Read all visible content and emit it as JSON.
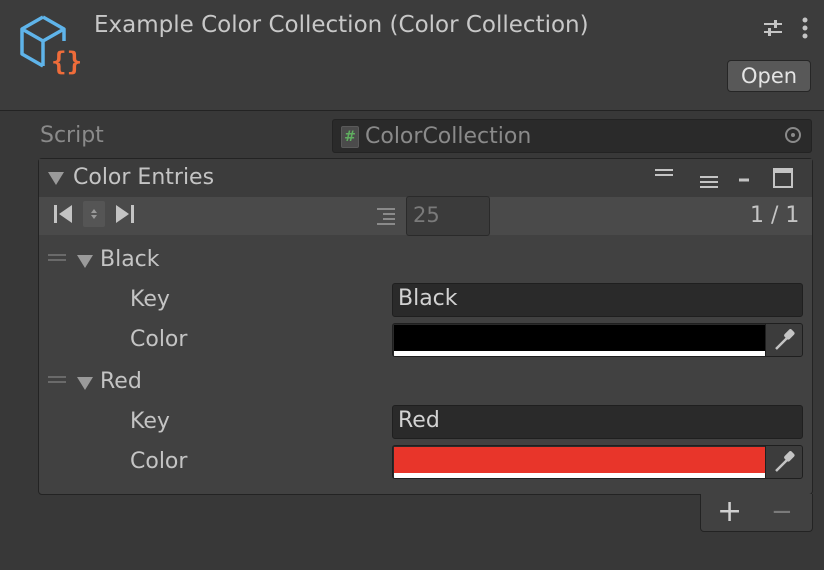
{
  "header": {
    "title": "Example Color Collection (Color Collection)",
    "open_label": "Open",
    "asset_icon": "scriptable-object-icon",
    "settings_icon": "sliders-icon",
    "menu_icon": "kebab-menu-icon"
  },
  "script": {
    "label": "Script",
    "value": "ColorCollection"
  },
  "list": {
    "title": "Color Entries",
    "page_size": "25",
    "page_indicator": "1 / 1",
    "entries": [
      {
        "name": "Black",
        "key_label": "Key",
        "key_value": "Black",
        "color_label": "Color",
        "color": "#000000"
      },
      {
        "name": "Red",
        "key_label": "Key",
        "key_value": "Red",
        "color_label": "Color",
        "color": "#e8352a"
      }
    ]
  },
  "footer": {
    "add_label": "+",
    "remove_label": "−"
  },
  "colors": {
    "background": "#383838",
    "field": "#2a2a2a",
    "icon_blue": "#5fb4ea",
    "icon_orange": "#ef6c3a"
  }
}
